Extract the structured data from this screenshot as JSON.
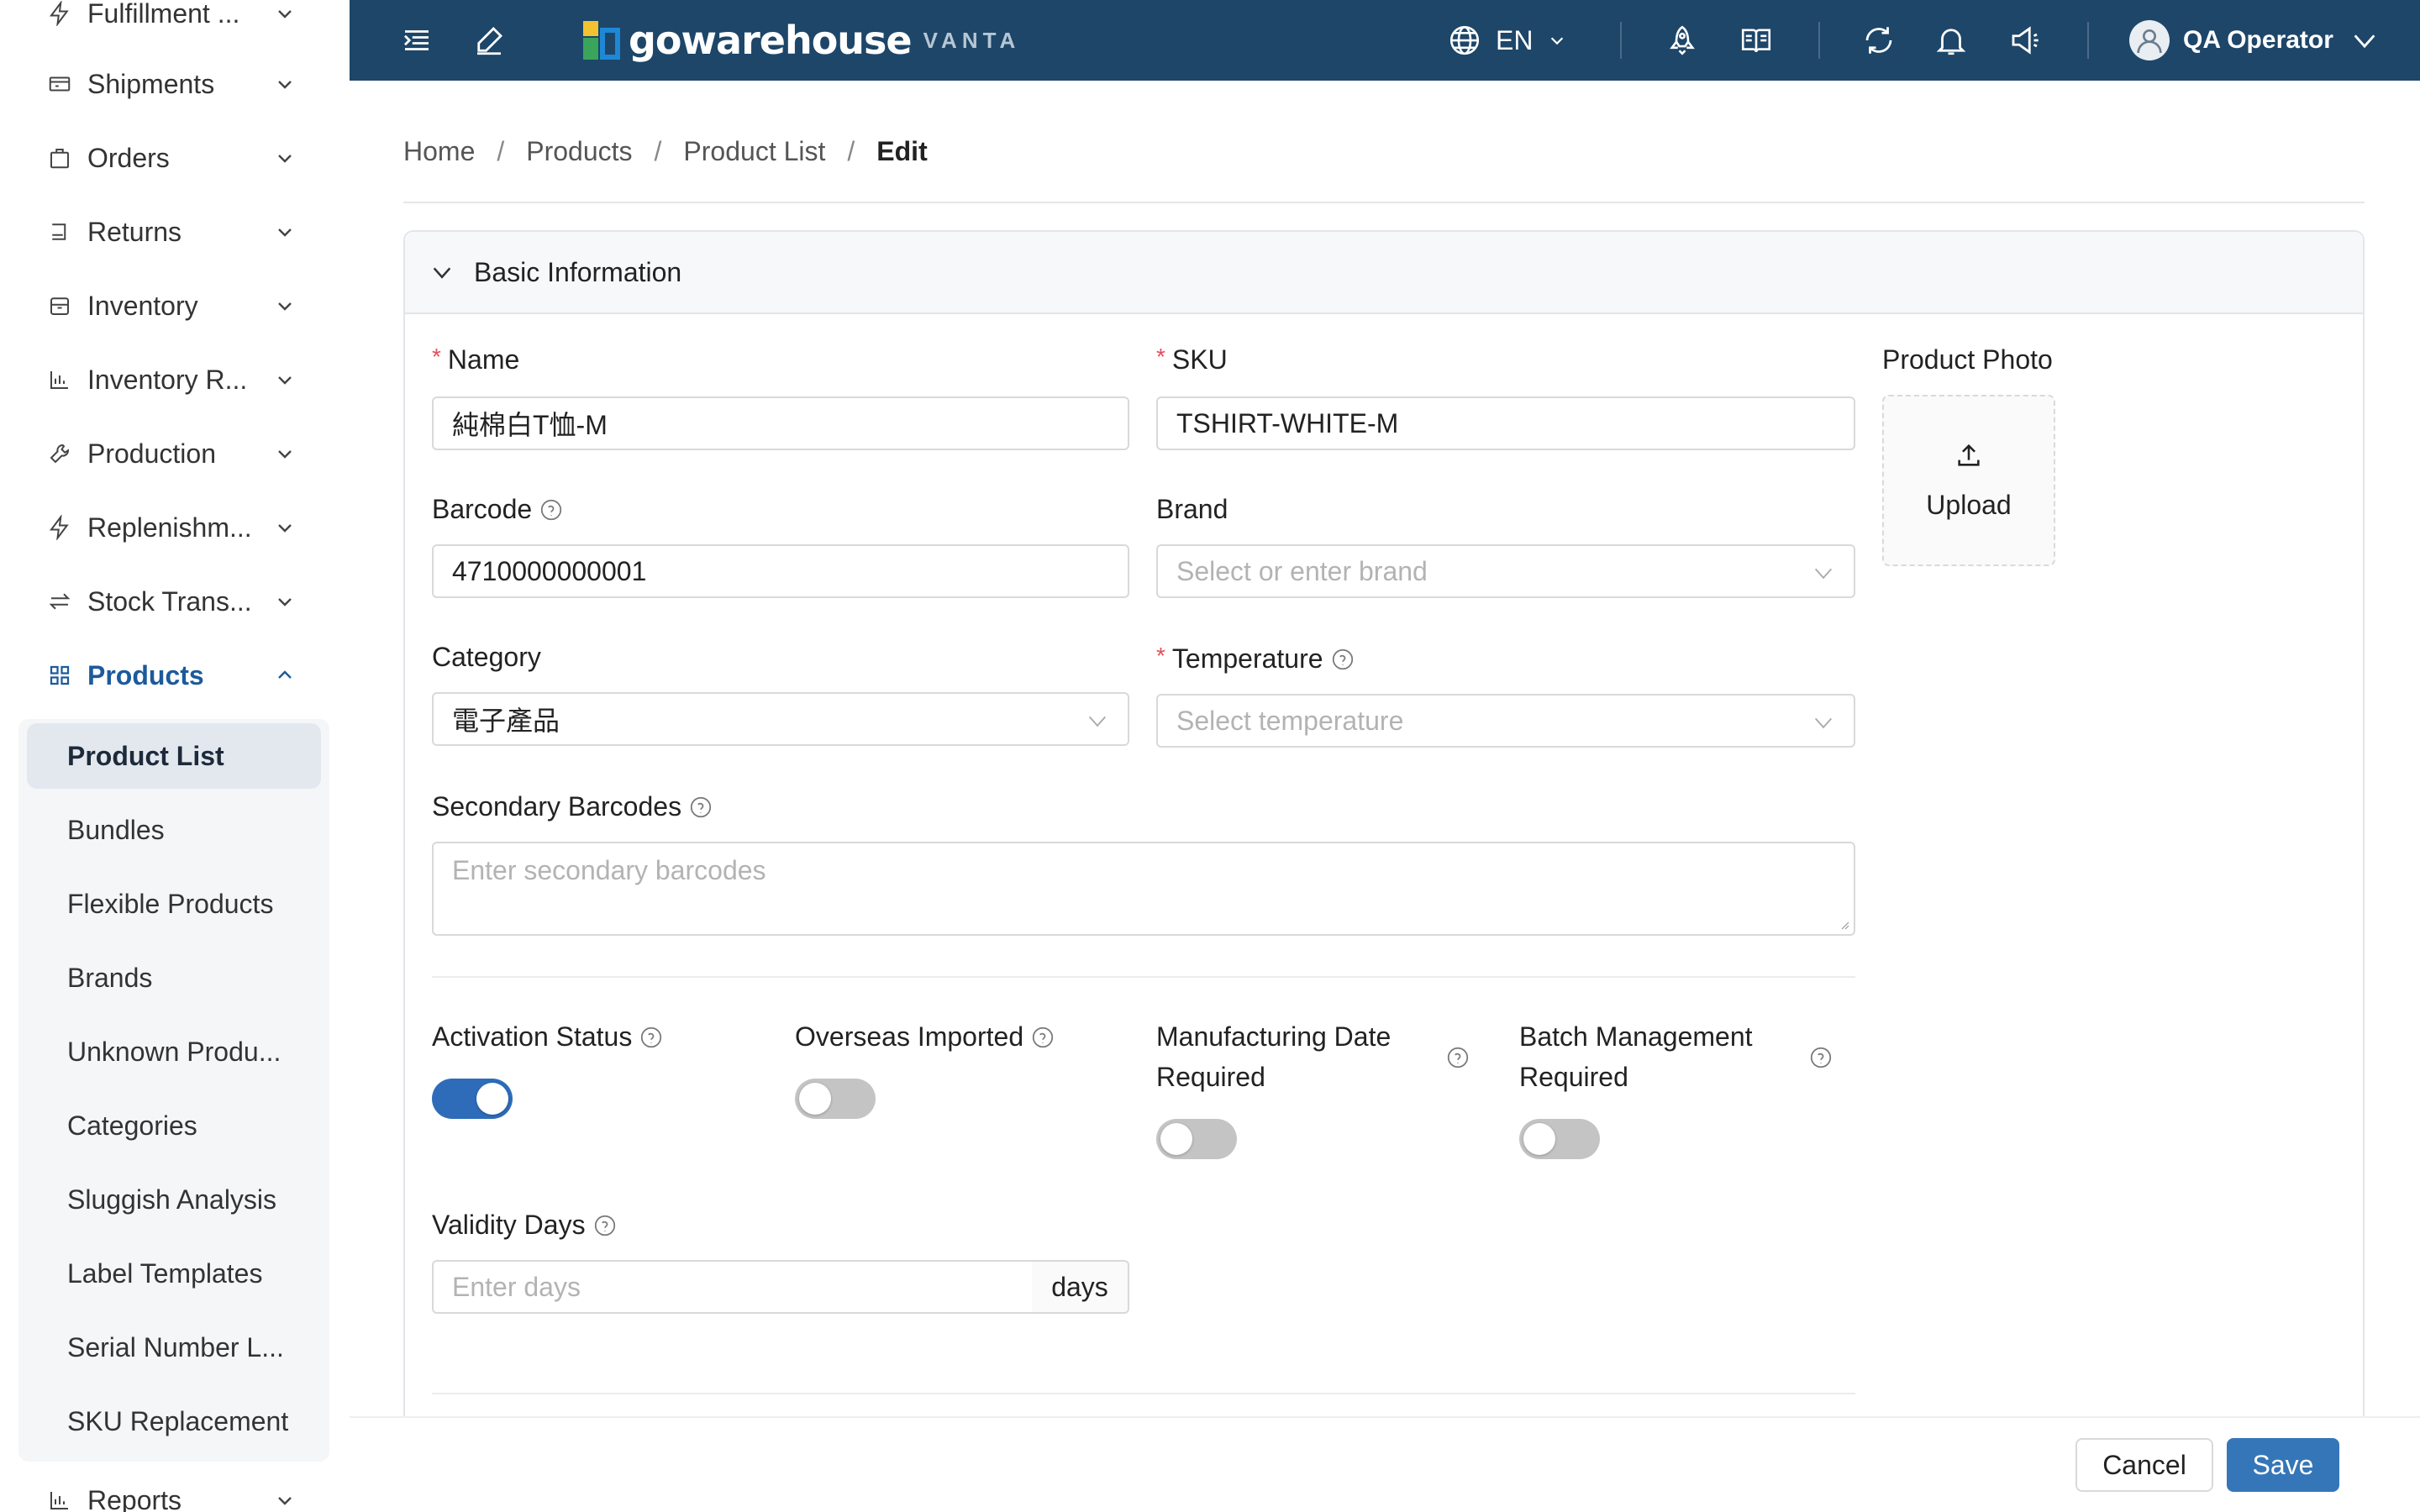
{
  "sidebar": {
    "items": [
      {
        "label": "Fulfillment ...",
        "icon": "bolt-icon"
      },
      {
        "label": "Shipments",
        "icon": "truck-icon"
      },
      {
        "label": "Orders",
        "icon": "bag-icon"
      },
      {
        "label": "Returns",
        "icon": "return-icon"
      },
      {
        "label": "Inventory",
        "icon": "box-icon"
      },
      {
        "label": "Inventory R...",
        "icon": "bar-chart-icon"
      },
      {
        "label": "Production",
        "icon": "wrench-icon"
      },
      {
        "label": "Replenishm...",
        "icon": "bolt-icon"
      },
      {
        "label": "Stock Trans...",
        "icon": "transfer-icon"
      },
      {
        "label": "Products",
        "icon": "grid-icon",
        "expanded": true
      },
      {
        "label": "Reports",
        "icon": "bar-chart-icon"
      }
    ],
    "products_submenu": [
      "Product List",
      "Bundles",
      "Flexible Products",
      "Brands",
      "Unknown Produ...",
      "Categories",
      "Sluggish Analysis",
      "Label Templates",
      "Serial Number L...",
      "SKU Replacement"
    ],
    "active_submenu": "Product List"
  },
  "header": {
    "logo_text": "gowarehouse",
    "logo_sub": "VANTA",
    "language": "EN",
    "user_name": "QA Operator",
    "icons": [
      "menu-fold-icon",
      "edit-icon",
      "globe-icon",
      "rocket-icon",
      "book-icon",
      "refresh-icon",
      "bell-icon",
      "megaphone-icon",
      "user-avatar-icon"
    ]
  },
  "breadcrumb": {
    "items": [
      "Home",
      "Products",
      "Product List"
    ],
    "current": "Edit",
    "separator": "/"
  },
  "section": {
    "title": "Basic Information"
  },
  "form": {
    "name": {
      "label": "Name",
      "required": true,
      "value": "純棉白T恤-M"
    },
    "sku": {
      "label": "SKU",
      "required": true,
      "value": "TSHIRT-WHITE-M"
    },
    "product_photo": {
      "label": "Product Photo",
      "upload_label": "Upload"
    },
    "barcode": {
      "label": "Barcode",
      "value": "4710000000001"
    },
    "brand": {
      "label": "Brand",
      "placeholder": "Select or enter brand"
    },
    "category": {
      "label": "Category",
      "value": "電子產品"
    },
    "temperature": {
      "label": "Temperature",
      "required": true,
      "placeholder": "Select temperature"
    },
    "secondary_barcodes": {
      "label": "Secondary Barcodes",
      "placeholder": "Enter secondary barcodes"
    },
    "activation_status": {
      "label": "Activation Status",
      "on": true
    },
    "overseas_imported": {
      "label": "Overseas Imported",
      "on": false
    },
    "manufacturing_date_required": {
      "label_line1": "Manufacturing Date",
      "label_line2": "Required",
      "on": false
    },
    "batch_management_required": {
      "label_line1": "Batch Management",
      "label_line2": "Required",
      "on": false
    },
    "validity_days": {
      "label": "Validity Days",
      "placeholder": "Enter days",
      "suffix": "days"
    }
  },
  "footer": {
    "cancel_label": "Cancel",
    "save_label": "Save"
  },
  "colors": {
    "header_bg": "#1d4669",
    "primary": "#3576b8",
    "toggle_on": "#2e6cba",
    "required_mark": "#e34d59",
    "active_nav": "#1c5a9c"
  }
}
